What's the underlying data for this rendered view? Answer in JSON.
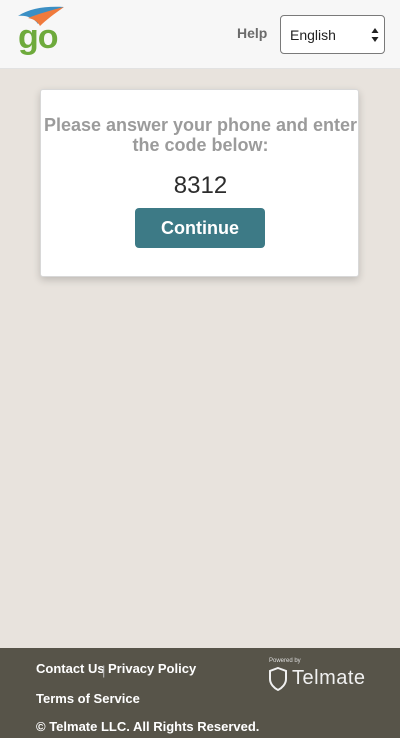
{
  "header": {
    "logo_text": "go",
    "help_label": "Help",
    "language": {
      "selected": "English"
    }
  },
  "card": {
    "prompt": "Please answer your phone and enter the code below:",
    "code": "8312",
    "continue_label": "Continue"
  },
  "footer": {
    "contact_us": "Contact Us",
    "separator": "|",
    "privacy_policy": "Privacy Policy",
    "terms_of_service": "Terms of Service",
    "copyright": "© Telmate LLC. All Rights Reserved.",
    "powered_by": "Powered by",
    "brand": "Telmate"
  },
  "colors": {
    "page_background": "#e8e3dd",
    "logo_green": "#6eaa3c",
    "button_teal": "#3d7a86",
    "footer_background": "#575449"
  },
  "icons": [
    "logo-swoosh-icon",
    "select-arrows-icon",
    "telmate-shield-icon"
  ]
}
